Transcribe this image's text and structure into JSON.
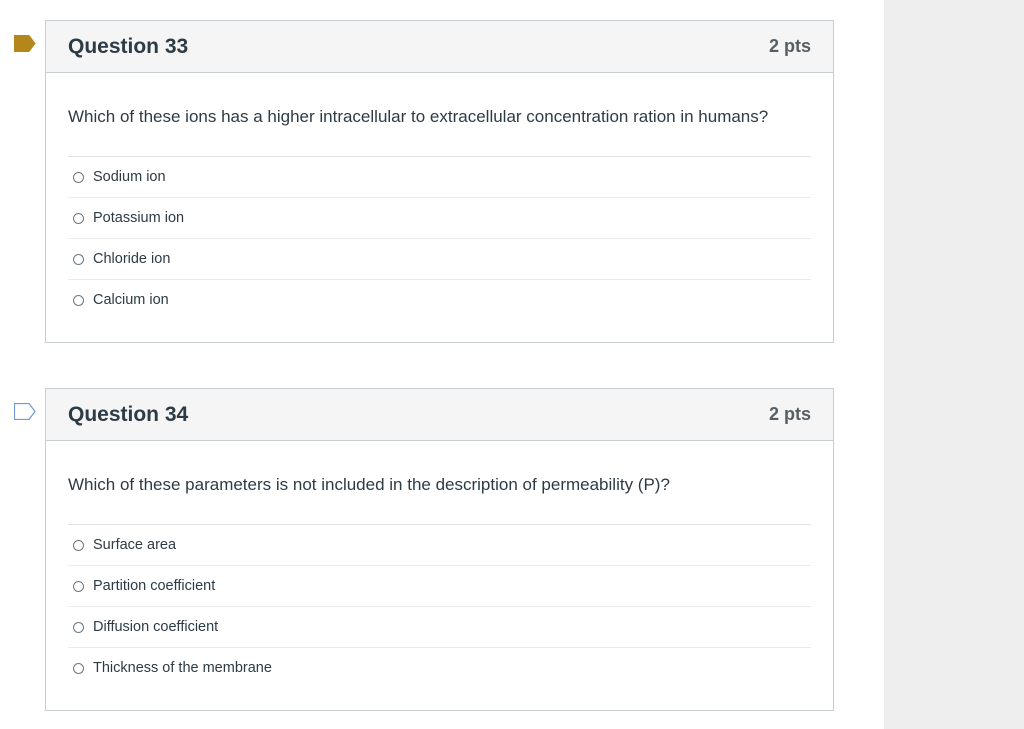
{
  "questions": [
    {
      "title": "Question 33",
      "points": "2 pts",
      "flagged": true,
      "flag_icon": "bookmark-flag-filled-icon",
      "text": "Which of these ions has a higher intracellular to extracellular concentration ration in humans?",
      "answers": [
        "Sodium ion",
        "Potassium ion",
        "Chloride ion",
        "Calcium ion"
      ]
    },
    {
      "title": "Question 34",
      "points": "2 pts",
      "flagged": false,
      "flag_icon": "bookmark-flag-outline-icon",
      "text": "Which of these parameters is not included in the description of permeability (P)?",
      "answers": [
        "Surface area",
        "Partition coefficient",
        "Diffusion coefficient",
        "Thickness of the membrane"
      ]
    }
  ],
  "colors": {
    "flag_filled": "#b3871a",
    "flag_outline": "#6f9bd1",
    "header_bg": "#f5f5f5",
    "side_panel_bg": "#eeeeee"
  }
}
